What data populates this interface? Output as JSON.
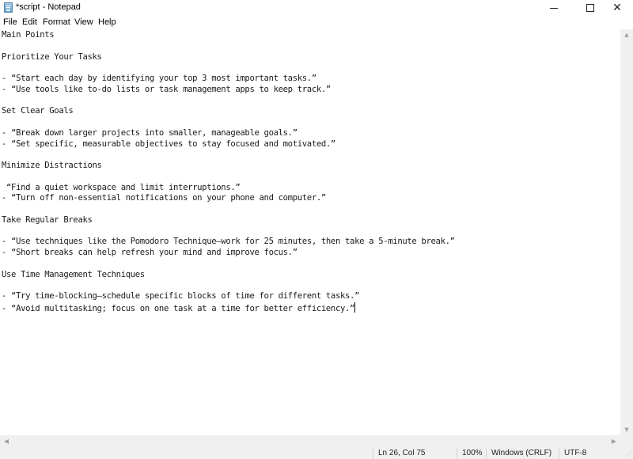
{
  "window": {
    "title": "*script - Notepad",
    "icon": "notepad-icon",
    "controls": {
      "minimize_icon": "minimize-icon",
      "maximize_icon": "maximize-icon",
      "close_icon": "close-icon",
      "close_glyph": "✕"
    }
  },
  "menubar": {
    "items": [
      {
        "label": "File"
      },
      {
        "label": "Edit"
      },
      {
        "label": "Format"
      },
      {
        "label": "View"
      },
      {
        "label": "Help"
      }
    ]
  },
  "editor": {
    "lines": [
      "Main Points",
      "",
      "Prioritize Your Tasks",
      "",
      "- “Start each day by identifying your top 3 most important tasks.”",
      "- “Use tools like to-do lists or task management apps to keep track.”",
      "",
      "Set Clear Goals",
      "",
      "- “Break down larger projects into smaller, manageable goals.”",
      "- “Set specific, measurable objectives to stay focused and motivated.”",
      "",
      "Minimize Distractions",
      "",
      " “Find a quiet workspace and limit interruptions.”",
      "- “Turn off non-essential notifications on your phone and computer.”",
      "",
      "Take Regular Breaks",
      "",
      "- “Use techniques like the Pomodoro Technique—work for 25 minutes, then take a 5-minute break.”",
      "- “Short breaks can help refresh your mind and improve focus.”",
      "",
      "Use Time Management Techniques",
      "",
      "- “Try time-blocking—schedule specific blocks of time for different tasks.”",
      "- “Avoid multitasking; focus on one task at a time for better efficiency.”"
    ],
    "caret_line": 26
  },
  "scrollbars": {
    "up_glyph": "▲",
    "down_glyph": "▼",
    "left_glyph": "◀",
    "right_glyph": "▶"
  },
  "statusbar": {
    "position": "Ln 26, Col 75",
    "zoom": "100%",
    "line_ending": "Windows (CRLF)",
    "encoding": "UTF-8",
    "grip_glyph": "⋰"
  }
}
